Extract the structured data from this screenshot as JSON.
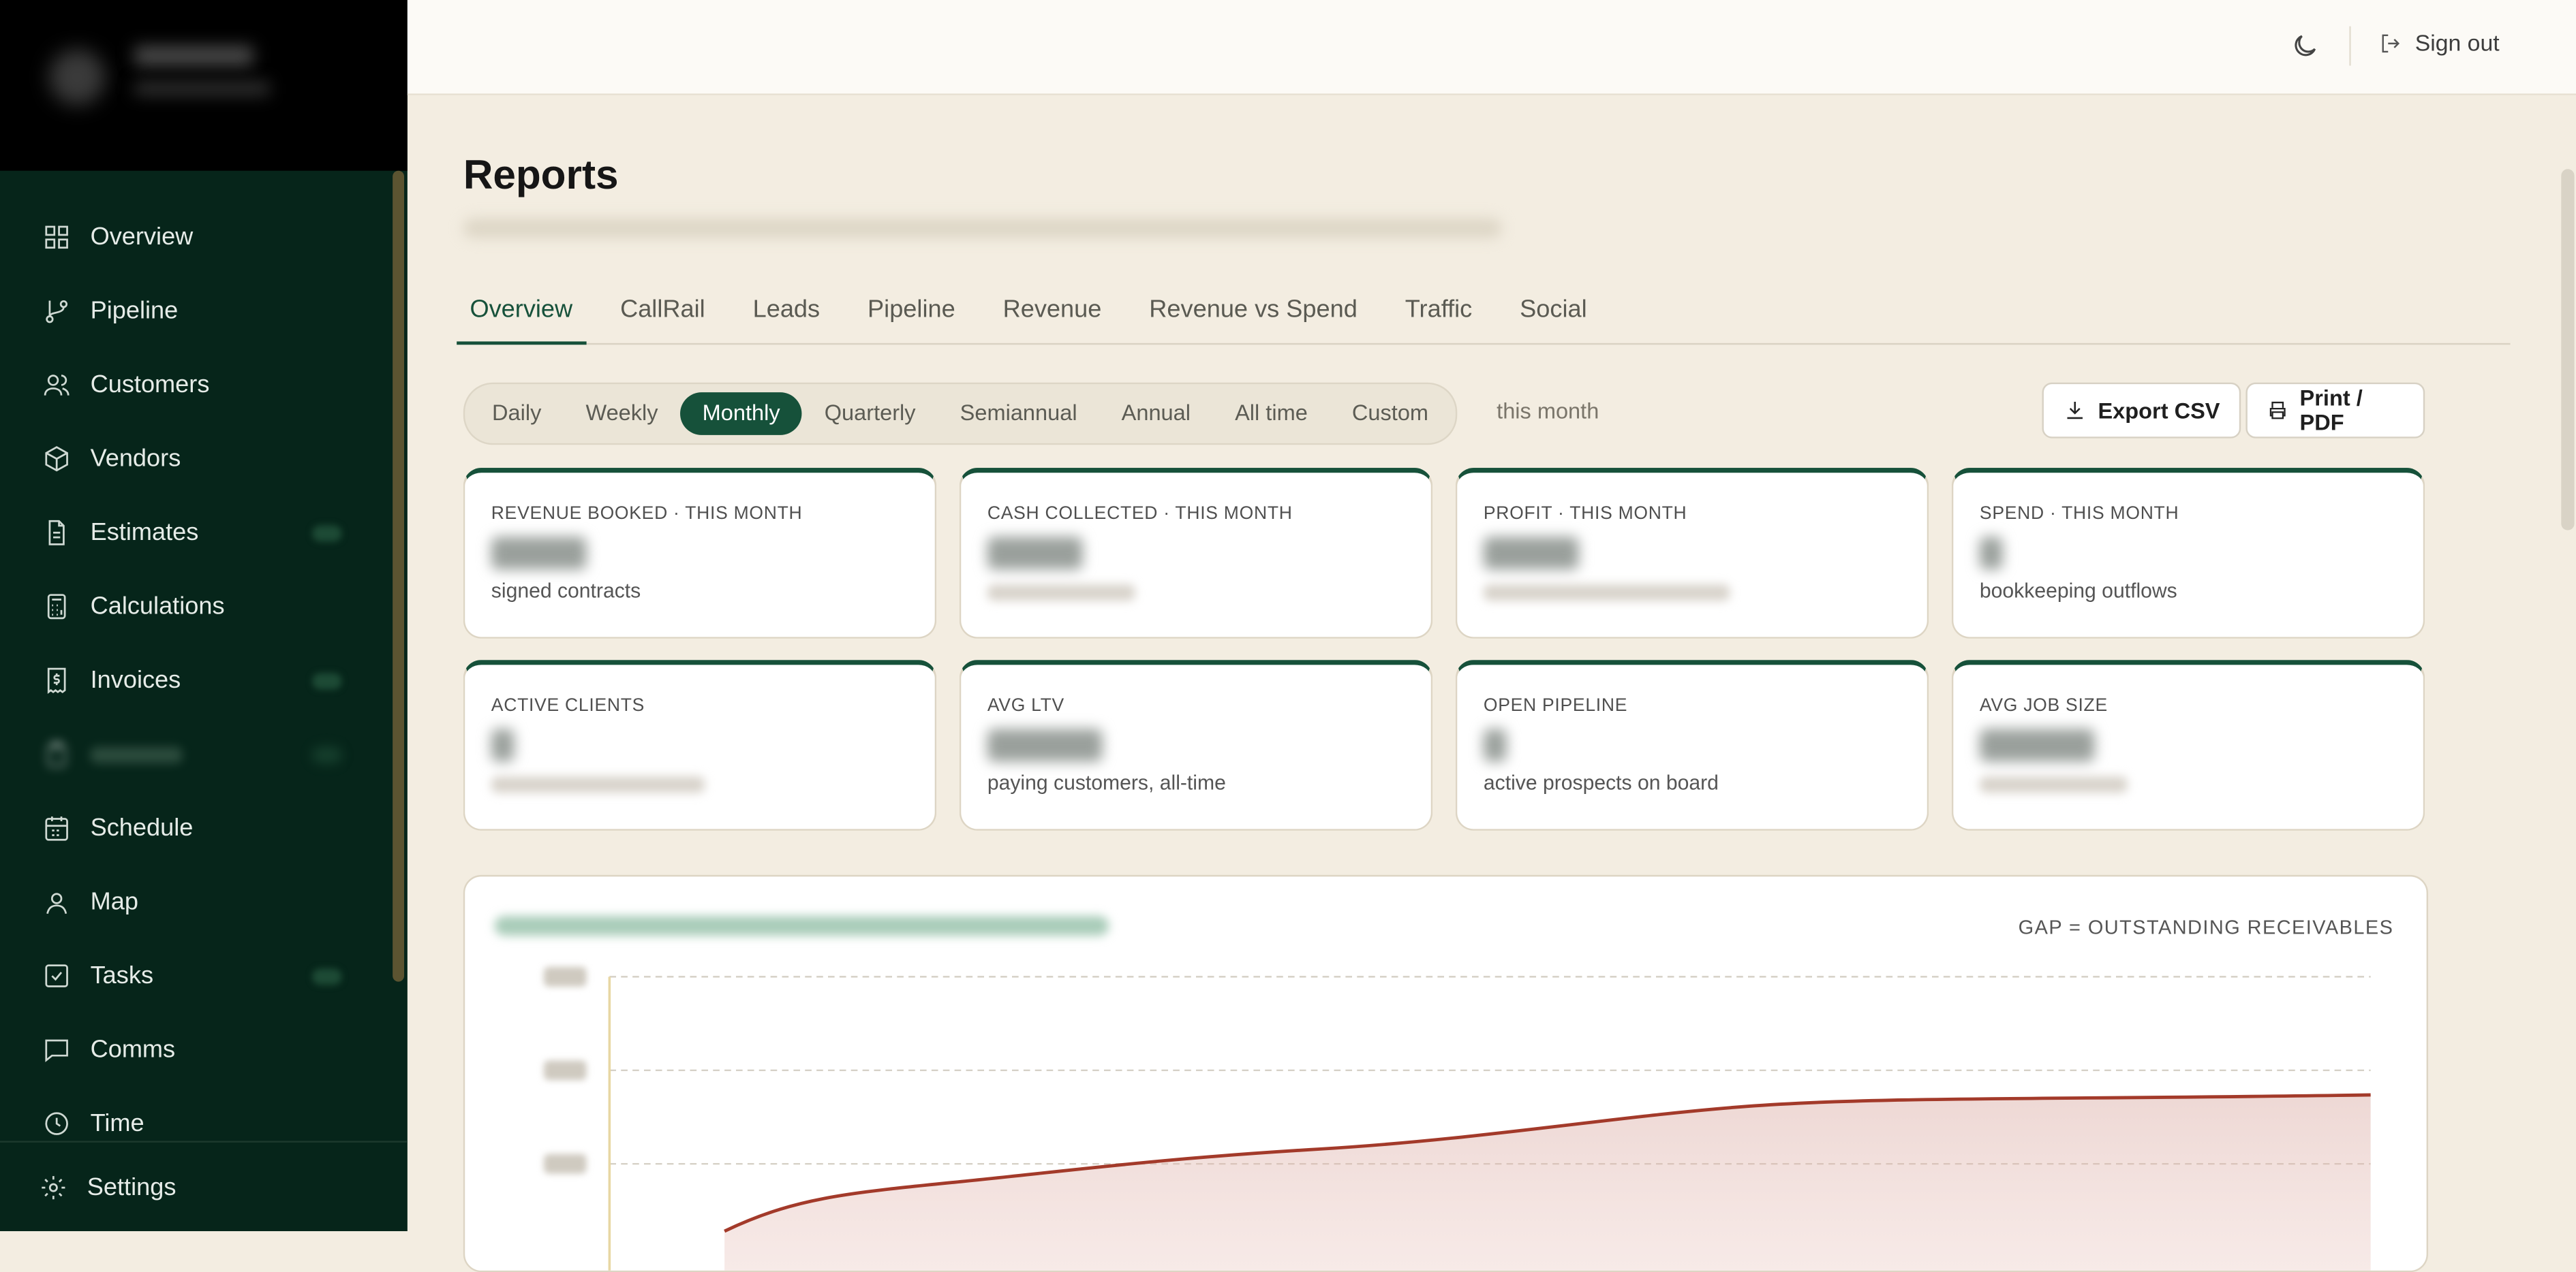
{
  "sidebar": {
    "items": [
      {
        "label": "Overview",
        "icon": "grid-icon"
      },
      {
        "label": "Pipeline",
        "icon": "git-branch-icon"
      },
      {
        "label": "Customers",
        "icon": "users-icon"
      },
      {
        "label": "Vendors",
        "icon": "box-icon"
      },
      {
        "label": "Estimates",
        "icon": "file-text-icon"
      },
      {
        "label": "Calculations",
        "icon": "calculator-icon"
      },
      {
        "label": "Invoices",
        "icon": "receipt-dollar-icon"
      },
      {
        "label": "",
        "icon": "clipboard-icon"
      },
      {
        "label": "Schedule",
        "icon": "calendar-icon"
      },
      {
        "label": "Map",
        "icon": "map-pin-icon"
      },
      {
        "label": "Tasks",
        "icon": "check-square-icon"
      },
      {
        "label": "Comms",
        "icon": "message-icon"
      },
      {
        "label": "Time",
        "icon": "clock-icon"
      }
    ],
    "settings_label": "Settings"
  },
  "topbar": {
    "signout_label": "Sign out"
  },
  "page": {
    "title": "Reports"
  },
  "tabs": [
    "Overview",
    "CallRail",
    "Leads",
    "Pipeline",
    "Revenue",
    "Revenue vs Spend",
    "Traffic",
    "Social"
  ],
  "periods": [
    "Daily",
    "Weekly",
    "Monthly",
    "Quarterly",
    "Semiannual",
    "Annual",
    "All time",
    "Custom"
  ],
  "period_label": "this month",
  "actions": {
    "export": "Export CSV",
    "print": "Print / PDF"
  },
  "cards": [
    {
      "label": "REVENUE BOOKED · THIS MONTH",
      "note": "signed contracts"
    },
    {
      "label": "CASH COLLECTED · THIS MONTH",
      "note": ""
    },
    {
      "label": "PROFIT · THIS MONTH",
      "note": ""
    },
    {
      "label": "SPEND · THIS MONTH",
      "note": "bookkeeping outflows"
    },
    {
      "label": "ACTIVE CLIENTS",
      "note": ""
    },
    {
      "label": "AVG LTV",
      "note": "paying customers, all-time"
    },
    {
      "label": "OPEN PIPELINE",
      "note": "active prospects on board"
    },
    {
      "label": "AVG JOB SIZE",
      "note": ""
    }
  ],
  "chart_note": "GAP = OUTSTANDING RECEIVABLES",
  "colors": {
    "sidebar": "#06251a",
    "accent": "#16513a",
    "booked": "#a33a2a",
    "page": "#f3ede1"
  }
}
